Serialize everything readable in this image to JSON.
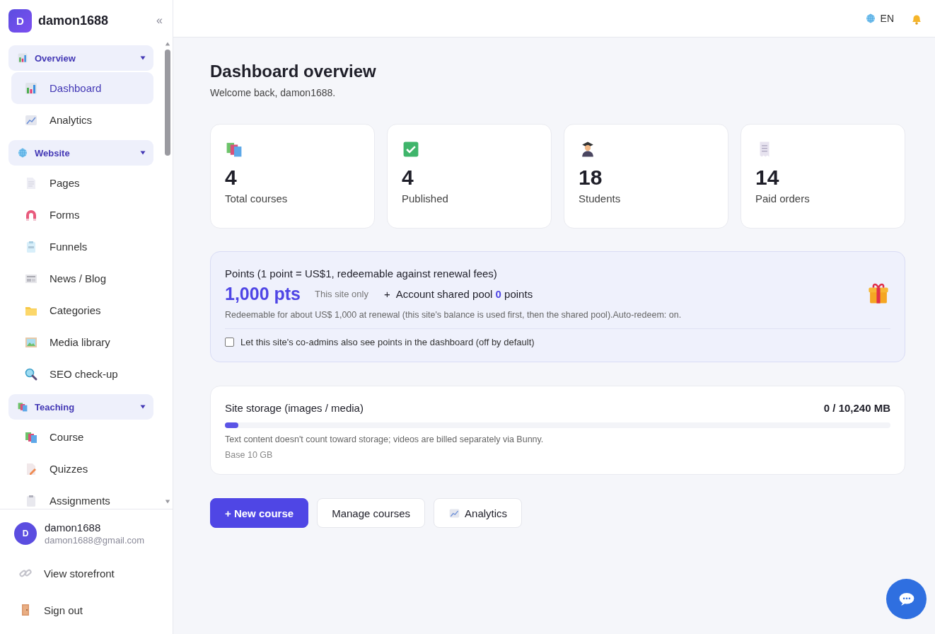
{
  "brand": {
    "initial": "D",
    "name": "damon1688"
  },
  "collapse": "«",
  "nav": [
    {
      "label": "Overview",
      "expanded": true,
      "children": [
        {
          "label": "Dashboard",
          "selected": true
        },
        {
          "label": "Analytics",
          "selected": false
        }
      ]
    },
    {
      "label": "Website",
      "expanded": true,
      "children": [
        {
          "label": "Pages",
          "selected": false
        },
        {
          "label": "Forms",
          "selected": false
        },
        {
          "label": "Funnels",
          "selected": false
        },
        {
          "label": "News / Blog",
          "selected": false
        },
        {
          "label": "Categories",
          "selected": false
        },
        {
          "label": "Media library",
          "selected": false
        },
        {
          "label": "SEO check-up",
          "selected": false
        }
      ]
    },
    {
      "label": "Teaching",
      "expanded": true,
      "children": [
        {
          "label": "Course",
          "selected": false
        },
        {
          "label": "Quizzes",
          "selected": false
        },
        {
          "label": "Assignments",
          "selected": false
        }
      ]
    }
  ],
  "user": {
    "initial": "D",
    "name": "damon1688",
    "email": "damon1688@gmail.com"
  },
  "footer_links": [
    "View storefront",
    "Sign out"
  ],
  "topbar": {
    "language": "EN"
  },
  "page": {
    "title": "Dashboard overview",
    "subtitle": "Welcome back, damon1688."
  },
  "stats": [
    {
      "value": "4",
      "label": "Total courses"
    },
    {
      "value": "4",
      "label": "Published"
    },
    {
      "value": "18",
      "label": "Students"
    },
    {
      "value": "14",
      "label": "Paid orders"
    }
  ],
  "points": {
    "title": "Points (1 point = US$1, redeemable against renewal fees)",
    "amount": "1,000 pts",
    "scope": "This site only",
    "plus": "+",
    "shared_prefix": "Account shared pool",
    "shared_value": "0",
    "shared_suffix": "points",
    "note": "Redeemable for about US$ 1,000 at renewal (this site's balance is used first, then the shared pool).Auto-redeem: on.",
    "checkbox": {
      "label": "Let this site's co-admins also see points in the dashboard (off by default)",
      "checked": false
    }
  },
  "storage": {
    "title": "Site storage (images / media)",
    "usage": "0 / 10,240 MB",
    "level": 0.02,
    "note": "Text content doesn't count toward storage; videos are billed separately via Bunny.",
    "base": "Base 10 GB"
  },
  "actions": [
    {
      "label": "+ New course",
      "kind": "primary"
    },
    {
      "label": "Manage courses",
      "kind": "plain"
    },
    {
      "label": "Analytics",
      "kind": "chart"
    }
  ]
}
